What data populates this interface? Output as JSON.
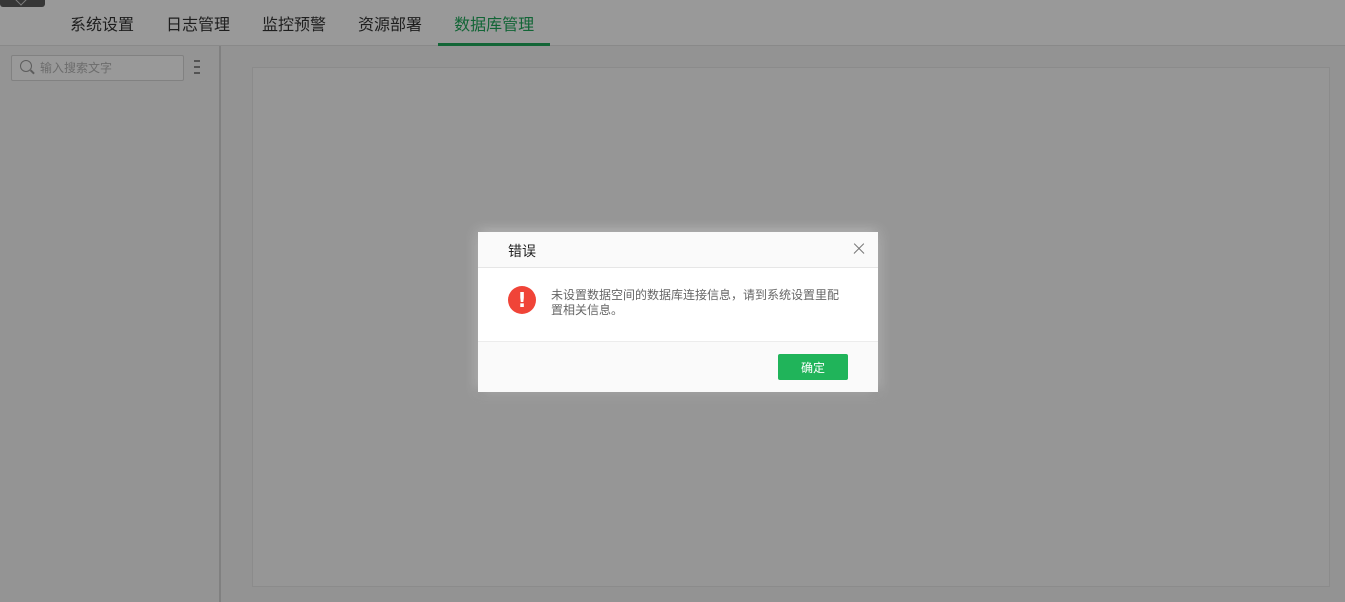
{
  "topbar": {
    "tabs": [
      {
        "label": "系统设置",
        "active": false
      },
      {
        "label": "日志管理",
        "active": false
      },
      {
        "label": "监控预警",
        "active": false
      },
      {
        "label": "资源部署",
        "active": false
      },
      {
        "label": "数据库管理",
        "active": true
      }
    ],
    "accent_color": "#1fa85a"
  },
  "sidebar": {
    "search": {
      "placeholder": "输入搜索文字",
      "value": ""
    }
  },
  "dialog": {
    "title": "错误",
    "icon": "error-icon",
    "icon_glyph": "!",
    "message": "未设置数据空间的数据库连接信息，请到系统设置里配置相关信息。",
    "ok_label": "确定",
    "ok_color": "#20b45a",
    "error_color": "#f04438"
  }
}
